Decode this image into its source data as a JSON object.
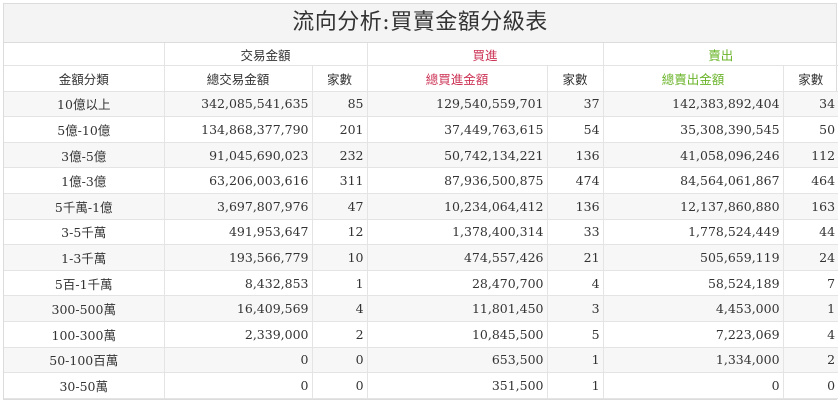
{
  "title": "流向分析:買賣金額分級表",
  "groups": {
    "trade": "交易金額",
    "buy": "買進",
    "sell": "賣出"
  },
  "columns": {
    "category": "金額分類",
    "total_trade": "總交易金額",
    "trade_count": "家數",
    "total_buy": "總買進金額",
    "buy_count": "家數",
    "total_sell": "總賣出金額",
    "sell_count": "家數"
  },
  "colors": {
    "buy": "#cc3355",
    "sell": "#6ab42a"
  },
  "rows": [
    {
      "category": "10億以上",
      "total_trade": "342,085,541,635",
      "trade_count": "85",
      "total_buy": "129,540,559,701",
      "buy_count": "37",
      "total_sell": "142,383,892,404",
      "sell_count": "34"
    },
    {
      "category": "5億-10億",
      "total_trade": "134,868,377,790",
      "trade_count": "201",
      "total_buy": "37,449,763,615",
      "buy_count": "54",
      "total_sell": "35,308,390,545",
      "sell_count": "50"
    },
    {
      "category": "3億-5億",
      "total_trade": "91,045,690,023",
      "trade_count": "232",
      "total_buy": "50,742,134,221",
      "buy_count": "136",
      "total_sell": "41,058,096,246",
      "sell_count": "112"
    },
    {
      "category": "1億-3億",
      "total_trade": "63,206,003,616",
      "trade_count": "311",
      "total_buy": "87,936,500,875",
      "buy_count": "474",
      "total_sell": "84,564,061,867",
      "sell_count": "464"
    },
    {
      "category": "5千萬-1億",
      "total_trade": "3,697,807,976",
      "trade_count": "47",
      "total_buy": "10,234,064,412",
      "buy_count": "136",
      "total_sell": "12,137,860,880",
      "sell_count": "163"
    },
    {
      "category": "3-5千萬",
      "total_trade": "491,953,647",
      "trade_count": "12",
      "total_buy": "1,378,400,314",
      "buy_count": "33",
      "total_sell": "1,778,524,449",
      "sell_count": "44"
    },
    {
      "category": "1-3千萬",
      "total_trade": "193,566,779",
      "trade_count": "10",
      "total_buy": "474,557,426",
      "buy_count": "21",
      "total_sell": "505,659,119",
      "sell_count": "24"
    },
    {
      "category": "5百-1千萬",
      "total_trade": "8,432,853",
      "trade_count": "1",
      "total_buy": "28,470,700",
      "buy_count": "4",
      "total_sell": "58,524,189",
      "sell_count": "7"
    },
    {
      "category": "300-500萬",
      "total_trade": "16,409,569",
      "trade_count": "4",
      "total_buy": "11,801,450",
      "buy_count": "3",
      "total_sell": "4,453,000",
      "sell_count": "1"
    },
    {
      "category": "100-300萬",
      "total_trade": "2,339,000",
      "trade_count": "2",
      "total_buy": "10,845,500",
      "buy_count": "5",
      "total_sell": "7,223,069",
      "sell_count": "4"
    },
    {
      "category": "50-100百萬",
      "total_trade": "0",
      "trade_count": "0",
      "total_buy": "653,500",
      "buy_count": "1",
      "total_sell": "1,334,000",
      "sell_count": "2"
    },
    {
      "category": "30-50萬",
      "total_trade": "0",
      "trade_count": "0",
      "total_buy": "351,500",
      "buy_count": "1",
      "total_sell": "0",
      "sell_count": "0"
    }
  ]
}
